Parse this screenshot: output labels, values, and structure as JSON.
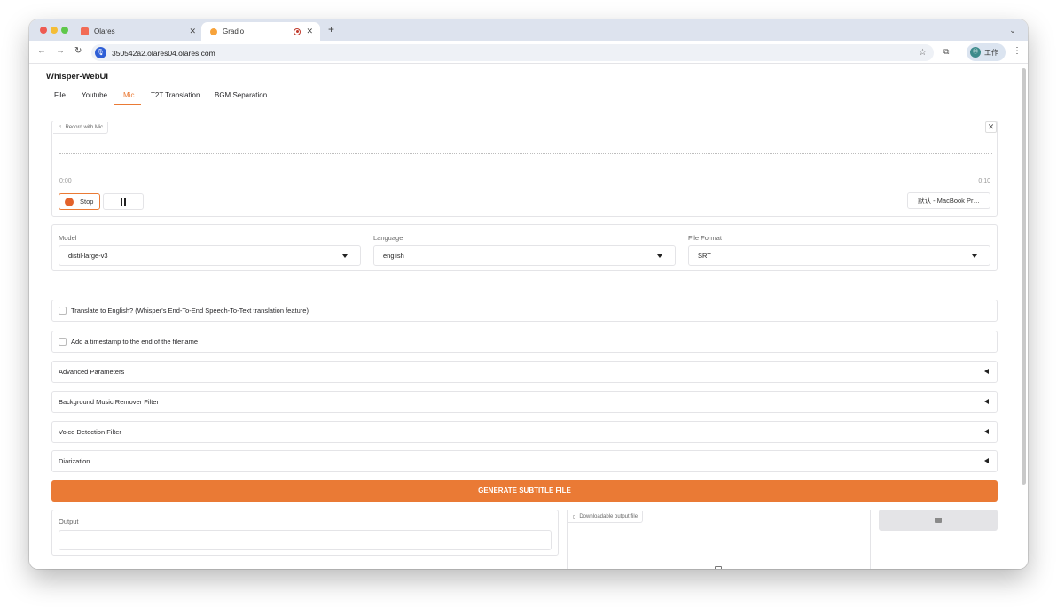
{
  "browser": {
    "tabs": [
      {
        "title": "Olares"
      },
      {
        "title": "Gradio"
      }
    ],
    "new_tab": "+",
    "url": "350542a2.olares04.olares.com",
    "profile_label": "工作",
    "profile_initial": "Ⓜ"
  },
  "app": {
    "title": "Whisper-WebUI",
    "tabs": [
      {
        "label": "File"
      },
      {
        "label": "Youtube"
      },
      {
        "label": "Mic"
      },
      {
        "label": "T2T Translation"
      },
      {
        "label": "BGM Separation"
      }
    ],
    "active_tab": "Mic"
  },
  "recorder": {
    "block_label": "Record with Mic",
    "time_start": "0:00",
    "time_end": "0:10",
    "stop_label": "Stop",
    "device_label": "默认 - MacBook Pr…"
  },
  "settings": {
    "model": {
      "label": "Model",
      "value": "distil-large-v3"
    },
    "language": {
      "label": "Language",
      "value": "english"
    },
    "file_format": {
      "label": "File Format",
      "value": "SRT"
    }
  },
  "options": {
    "translate": {
      "label": "Translate to English? (Whisper's End-To-End Speech-To-Text translation feature)",
      "checked": false
    },
    "timestamp": {
      "label": "Add a timestamp to the end of the filename",
      "checked": false
    }
  },
  "accordions": [
    {
      "label": "Advanced Parameters"
    },
    {
      "label": "Background Music Remover Filter"
    },
    {
      "label": "Voice Detection Filter"
    },
    {
      "label": "Diarization"
    }
  ],
  "generate_label": "GENERATE SUBTITLE FILE",
  "output": {
    "label": "Output",
    "value": "",
    "download_label": "Downloadable output file"
  },
  "colors": {
    "accent": "#ea7a35"
  }
}
